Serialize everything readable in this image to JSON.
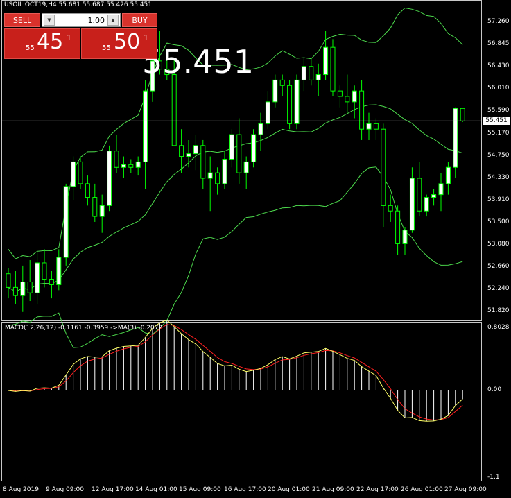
{
  "chart_header": {
    "symbol_line": "USOIL.OCT19,H4  55.681 55.687 55.426 55.451"
  },
  "big_price": "55.451",
  "current_price_tag": "55.451",
  "trade_panel": {
    "sell_label": "SELL",
    "buy_label": "BUY",
    "volume": "1.00",
    "sell_quote": {
      "small": "55",
      "big": "45",
      "sup": "1"
    },
    "buy_quote": {
      "small": "55",
      "big": "50",
      "sup": "1"
    },
    "sell_color": "#c8201b"
  },
  "price_axis": [
    "57.260",
    "56.845",
    "56.430",
    "56.010",
    "55.590",
    "55.170",
    "54.750",
    "54.330",
    "53.910",
    "53.500",
    "53.080",
    "52.660",
    "52.240",
    "51.820"
  ],
  "macd": {
    "title": "MACD(12,26,12) -0.1161 -0.3959  ->MA(3) -0.2072",
    "axis": [
      "0.8028",
      "0.00",
      "-1.1"
    ],
    "main_color": "#ffff66",
    "signal_color": "#ff2020"
  },
  "time_axis": [
    "8 Aug 2019",
    "9 Aug 09:00",
    "12 Aug 17:00",
    "14 Aug 01:00",
    "15 Aug 09:00",
    "16 Aug 17:00",
    "20 Aug 01:00",
    "21 Aug 09:00",
    "22 Aug 17:00",
    "26 Aug 01:00",
    "27 Aug 09:00"
  ],
  "colors": {
    "bull": "#ffffff",
    "bear": "#000000",
    "wick": "#00ff00",
    "bands": "#4ddc4d",
    "background": "#000000"
  },
  "chart_data": {
    "type": "candlestick",
    "title": "USOIL.OCT19,H4",
    "ylim": [
      51.82,
      57.5
    ],
    "ohlc": [
      [
        52.65,
        52.75,
        52.2,
        52.4
      ],
      [
        52.4,
        52.7,
        52.1,
        52.25
      ],
      [
        52.25,
        52.8,
        51.95,
        52.5
      ],
      [
        52.5,
        52.9,
        52.15,
        52.3
      ],
      [
        52.3,
        53.05,
        52.1,
        52.85
      ],
      [
        52.85,
        53.1,
        52.4,
        52.55
      ],
      [
        52.55,
        52.7,
        52.2,
        52.45
      ],
      [
        52.45,
        53.1,
        52.35,
        52.95
      ],
      [
        52.95,
        54.3,
        52.8,
        54.25
      ],
      [
        54.25,
        54.8,
        54.0,
        54.7
      ],
      [
        54.7,
        54.8,
        54.2,
        54.3
      ],
      [
        54.3,
        54.45,
        53.9,
        54.05
      ],
      [
        54.05,
        54.3,
        53.6,
        53.7
      ],
      [
        53.7,
        54.1,
        53.4,
        53.9
      ],
      [
        53.9,
        55.0,
        53.8,
        54.9
      ],
      [
        54.9,
        55.2,
        54.5,
        54.6
      ],
      [
        54.6,
        54.8,
        54.4,
        54.65
      ],
      [
        54.65,
        54.75,
        54.5,
        54.6
      ],
      [
        54.6,
        54.8,
        54.45,
        54.7
      ],
      [
        54.7,
        56.2,
        54.2,
        56.0
      ],
      [
        56.0,
        56.7,
        55.8,
        56.55
      ],
      [
        56.55,
        57.1,
        56.3,
        56.4
      ],
      [
        56.4,
        56.6,
        56.2,
        56.3
      ],
      [
        56.3,
        56.6,
        55.0,
        55.0
      ],
      [
        55.0,
        55.3,
        54.5,
        54.8
      ],
      [
        54.8,
        55.1,
        54.6,
        54.85
      ],
      [
        54.85,
        55.2,
        54.55,
        55.0
      ],
      [
        55.0,
        55.1,
        54.2,
        54.4
      ],
      [
        54.4,
        54.8,
        53.8,
        54.5
      ],
      [
        54.5,
        54.6,
        54.1,
        54.3
      ],
      [
        54.3,
        54.9,
        54.2,
        54.75
      ],
      [
        54.75,
        55.3,
        54.6,
        55.2
      ],
      [
        55.2,
        55.5,
        54.3,
        54.5
      ],
      [
        54.5,
        54.8,
        54.2,
        54.7
      ],
      [
        54.7,
        55.3,
        54.6,
        55.2
      ],
      [
        55.2,
        55.6,
        54.9,
        55.4
      ],
      [
        55.4,
        56.0,
        55.3,
        55.8
      ],
      [
        55.8,
        56.3,
        55.7,
        56.2
      ],
      [
        56.2,
        56.3,
        55.9,
        56.1
      ],
      [
        56.1,
        56.2,
        55.3,
        55.4
      ],
      [
        55.4,
        56.3,
        55.3,
        56.2
      ],
      [
        56.2,
        56.6,
        56.0,
        56.45
      ],
      [
        56.45,
        56.6,
        56.1,
        56.2
      ],
      [
        56.2,
        56.5,
        55.9,
        56.3
      ],
      [
        56.3,
        57.1,
        56.2,
        56.8
      ],
      [
        56.8,
        56.95,
        55.9,
        56.0
      ],
      [
        56.0,
        56.1,
        55.7,
        55.9
      ],
      [
        55.9,
        56.3,
        55.6,
        55.8
      ],
      [
        55.8,
        56.1,
        55.5,
        56.0
      ],
      [
        56.0,
        56.2,
        55.1,
        55.3
      ],
      [
        55.3,
        55.6,
        55.1,
        55.4
      ],
      [
        55.4,
        55.5,
        55.1,
        55.3
      ],
      [
        55.3,
        55.4,
        53.5,
        53.9
      ],
      [
        53.9,
        54.1,
        53.6,
        53.8
      ],
      [
        53.8,
        53.9,
        53.0,
        53.2
      ],
      [
        53.2,
        53.5,
        53.0,
        53.45
      ],
      [
        53.45,
        54.6,
        53.4,
        54.4
      ],
      [
        54.4,
        54.7,
        53.7,
        53.8
      ],
      [
        53.8,
        54.1,
        53.7,
        54.05
      ],
      [
        54.05,
        54.2,
        53.9,
        54.1
      ],
      [
        54.1,
        54.5,
        53.8,
        54.3
      ],
      [
        54.3,
        54.7,
        54.1,
        54.6
      ],
      [
        54.6,
        55.7,
        54.4,
        55.68
      ],
      [
        55.68,
        55.69,
        55.43,
        55.45
      ]
    ]
  }
}
